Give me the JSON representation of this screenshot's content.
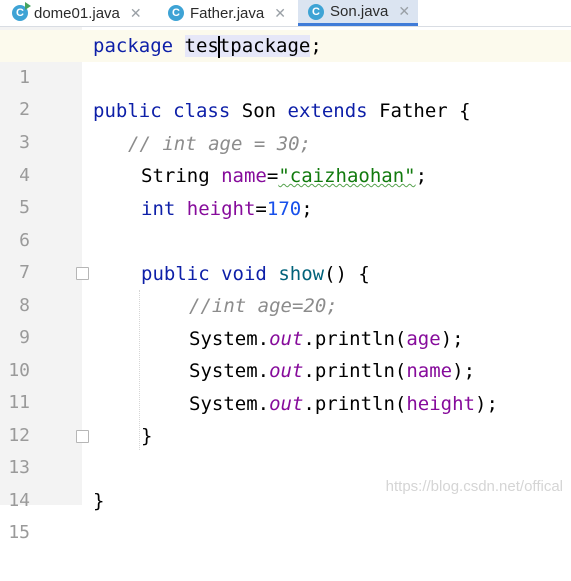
{
  "tabs": [
    {
      "label": "dome01.java",
      "close": "✕"
    },
    {
      "label": "Father.java",
      "close": "✕"
    },
    {
      "label": "Son.java",
      "close": "✕"
    }
  ],
  "icons": {
    "class_icon": "C"
  },
  "lines": {
    "n1": "1",
    "n2": "2",
    "n3": "3",
    "n4": "4",
    "n5": "5",
    "n6": "6",
    "n7": "7",
    "n8": "8",
    "n9": "9",
    "n10": "10",
    "n11": "11",
    "n12": "12",
    "n13": "13",
    "n14": "14",
    "n15": "15"
  },
  "code": {
    "l1_kw": "package",
    "l1_a": "tes",
    "l1_b": "tpackage",
    "l1_semi": ";",
    "l3_kw1": "public",
    "l3_kw2": "class",
    "l3_name": "Son",
    "l3_kw3": "extends",
    "l3_parent": "Father",
    "l3_brace": "{",
    "l4_comment": "// int age = 30;",
    "l5_type": "String",
    "l5_field": "name",
    "l5_eq": "=",
    "l5_str": "\"caizhaohan\"",
    "l5_semi": ";",
    "l6_type": "int",
    "l6_field": "height",
    "l6_eq": "=",
    "l6_num": "170",
    "l6_semi": ";",
    "l8_kw1": "public",
    "l8_kw2": "void",
    "l8_method": "show",
    "l8_rest": "() {",
    "l9_comment": "//int age=20;",
    "l10_sys": "System.",
    "l10_out": "out",
    "l10_println": ".println(",
    "l10_arg": "age",
    "l10_end": ");",
    "l11_sys": "System.",
    "l11_out": "out",
    "l11_println": ".println(",
    "l11_arg": "name",
    "l11_end": ");",
    "l12_sys": "System.",
    "l12_out": "out",
    "l12_println": ".println(",
    "l12_arg": "height",
    "l12_end": ");",
    "l13_brace": "}",
    "l15_brace": "}"
  },
  "watermark": "https://blog.csdn.net/offical",
  "colors": {
    "keyword": "#0d1fa8",
    "string": "#117a0d",
    "field": "#860b9b",
    "number": "#1750eb",
    "comment": "#8c8c8c"
  }
}
